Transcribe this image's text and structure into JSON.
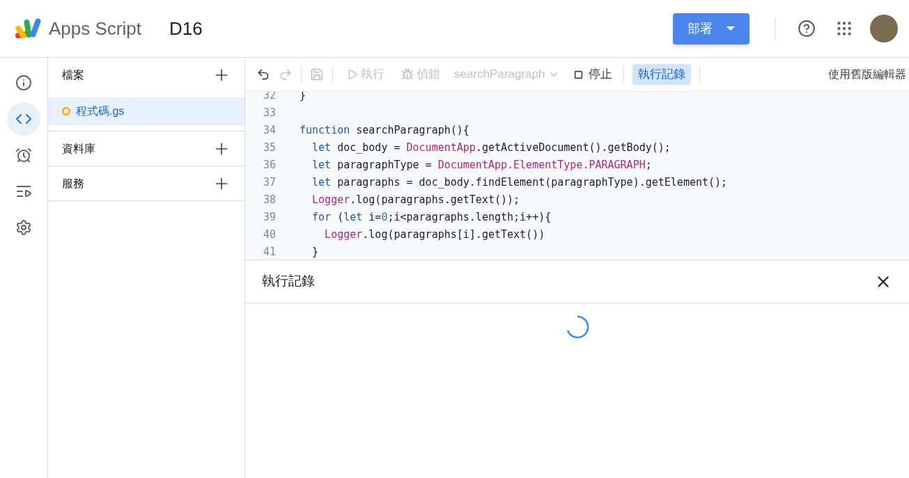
{
  "header": {
    "product": "Apps Script",
    "project": "D16",
    "deploy_button": "部署"
  },
  "rail": [
    {
      "kind": "info",
      "selected": false
    },
    {
      "kind": "code",
      "selected": true
    },
    {
      "kind": "triggers",
      "selected": false
    },
    {
      "kind": "executions",
      "selected": false
    },
    {
      "kind": "settings",
      "selected": false
    }
  ],
  "sidebar": {
    "sections": [
      {
        "title": "檔案",
        "files": [
          {
            "name": "程式碼.gs",
            "selected": true,
            "unsaved": true
          }
        ]
      },
      {
        "title": "資料庫"
      },
      {
        "title": "服務"
      }
    ]
  },
  "toolbar": {
    "undo_disabled": false,
    "redo_disabled": true,
    "save_disabled": true,
    "run": {
      "label": "執行",
      "disabled": true
    },
    "debug": {
      "label": "偵錯",
      "disabled": true
    },
    "function_select": {
      "value": "searchParagraph",
      "disabled": true
    },
    "stop": {
      "label": "停止",
      "disabled": false
    },
    "log_toggle": {
      "label": "執行記錄",
      "selected": true
    },
    "legacy_link": "使用舊版編輯器"
  },
  "code_lines": [
    {
      "number": "32",
      "tokens": [
        {
          "kind": "plain",
          "text": "}"
        }
      ]
    },
    {
      "number": "33"
    },
    {
      "number": "34",
      "tokens": [
        {
          "kind": "keyword",
          "text": "function"
        },
        {
          "kind": "plain",
          "text": " searchParagraph(){"
        }
      ]
    },
    {
      "number": "35",
      "tokens": [
        {
          "kind": "keyword",
          "text": "  let"
        },
        {
          "kind": "plain",
          "text": " doc_body = "
        },
        {
          "kind": "class",
          "text": "DocumentApp"
        },
        {
          "kind": "plain",
          "text": ".getActiveDocument().getBody();"
        }
      ]
    },
    {
      "number": "36",
      "tokens": [
        {
          "kind": "keyword",
          "text": "  let"
        },
        {
          "kind": "plain",
          "text": " paragraphType = "
        },
        {
          "kind": "class",
          "text": "DocumentApp.ElementType.PARAGRAPH"
        },
        {
          "kind": "plain",
          "text": ";"
        }
      ]
    },
    {
      "number": "37",
      "tokens": [
        {
          "kind": "keyword",
          "text": "  let"
        },
        {
          "kind": "plain",
          "text": " paragraphs = doc_body.findElement(paragraphType).getElement();"
        }
      ]
    },
    {
      "number": "38",
      "tokens": [
        {
          "kind": "class",
          "text": "  Logger"
        },
        {
          "kind": "plain",
          "text": ".log(paragraphs.getText());"
        }
      ]
    },
    {
      "number": "39",
      "tokens": [
        {
          "kind": "keyword",
          "text": "  for"
        },
        {
          "kind": "plain",
          "text": " ("
        },
        {
          "kind": "keyword",
          "text": "let"
        },
        {
          "kind": "plain",
          "text": " i="
        },
        {
          "kind": "number",
          "text": "0"
        },
        {
          "kind": "plain",
          "text": ";i<paragraphs.length;i++){"
        }
      ]
    },
    {
      "number": "40",
      "tokens": [
        {
          "kind": "class",
          "text": "    Logger"
        },
        {
          "kind": "plain",
          "text": ".log(paragraphs[i].getText())"
        }
      ]
    },
    {
      "number": "41",
      "tokens": [
        {
          "kind": "plain",
          "text": "  }"
        }
      ]
    }
  ],
  "log_panel": {
    "title": "執行記錄",
    "loading": true
  }
}
